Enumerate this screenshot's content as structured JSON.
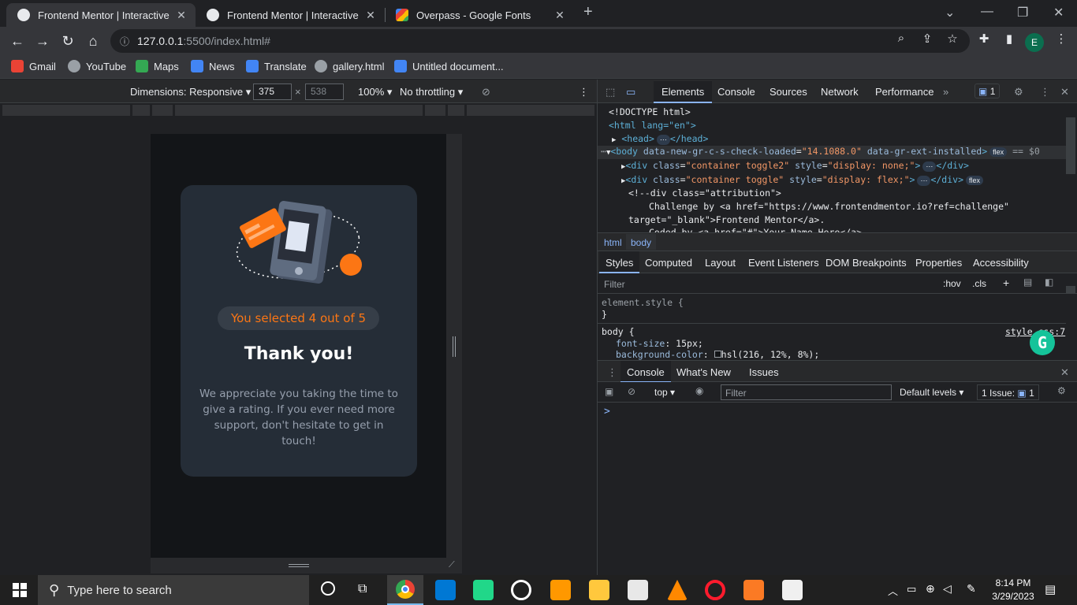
{
  "browser": {
    "tabs": [
      {
        "title": "Frontend Mentor | Interactive rat",
        "active": true
      },
      {
        "title": "Frontend Mentor | Interactive rat",
        "active": false
      },
      {
        "title": "Overpass - Google Fonts",
        "active": false
      }
    ],
    "new_tab_icon": "plus-icon",
    "url_host": "127.0.0.1",
    "url_rest": ":5500/index.html#",
    "profile_initial": "E",
    "bookmarks": [
      {
        "label": "Gmail",
        "color": "#ea4335"
      },
      {
        "label": "YouTube",
        "color": "#e8eaed"
      },
      {
        "label": "Maps",
        "color": "#34a853"
      },
      {
        "label": "News",
        "color": "#4285f4"
      },
      {
        "label": "Translate",
        "color": "#4285f4"
      },
      {
        "label": "gallery.html",
        "color": "#e8eaed"
      },
      {
        "label": "Untitled document...",
        "color": "#4285f4"
      }
    ]
  },
  "device_toolbar": {
    "dimensions_label": "Dimensions: Responsive",
    "width": "375",
    "height": "538",
    "zoom": "100%",
    "throttling": "No throttling"
  },
  "app": {
    "badge": "You selected 4 out of 5",
    "heading": "Thank you!",
    "description": "We appreciate you taking the time to give a rating. If you ever need more support, don't hesitate to get in touch!",
    "accent_color": "#fc7614"
  },
  "devtools": {
    "tabs": [
      "Elements",
      "Console",
      "Sources",
      "Network",
      "Performance"
    ],
    "issues_count": "1",
    "elements": {
      "doctype": "<!DOCTYPE html>",
      "html_open": "<html lang=\"en\">",
      "head": "<head>",
      "head_close": "</head>",
      "body_attr1": "data-new-gr-c-s-check-loaded",
      "body_val1": "\"14.1088.0\"",
      "body_attr2": "data-gr-ext-installed",
      "body_suffix": "== $0",
      "div1_class": "\"container toggle2\"",
      "div1_style": "\"display: none;\"",
      "div2_class": "\"container toggle\"",
      "div2_style": "\"display: flex;\"",
      "comment1": "<!--div class=\"attribution\">",
      "comment2": "Challenge by <a href=\"https://www.frontendmentor.io?ref=challenge\"",
      "comment3": "target=\"_blank\">Frontend Mentor</a>.",
      "comment4": "Coded by <a href=\"#\">Your Name Here</a>."
    },
    "breadcrumbs": [
      "html",
      "body"
    ],
    "style_tabs": [
      "Styles",
      "Computed",
      "Layout",
      "Event Listeners",
      "DOM Breakpoints",
      "Properties",
      "Accessibility"
    ],
    "filter_placeholder": "Filter",
    "hov": ":hov",
    "cls": ".cls",
    "styles": {
      "element_style": "element.style {",
      "close_brace": "}",
      "body_selector": "body {",
      "source": "style.css:7",
      "prop1": "font-size",
      "val1": "15px;",
      "prop2": "background-color",
      "val2": "hsl(216, 12%, 8%);"
    },
    "drawer_tabs": [
      "Console",
      "What's New",
      "Issues"
    ],
    "console_context": "top",
    "console_filter_placeholder": "Filter",
    "default_levels": "Default levels",
    "issues_label": "1 Issue:",
    "issues_badge": "1",
    "prompt": ">"
  },
  "taskbar": {
    "search_placeholder": "Type here to search",
    "time": "8:14 PM",
    "date": "3/29/2023"
  }
}
